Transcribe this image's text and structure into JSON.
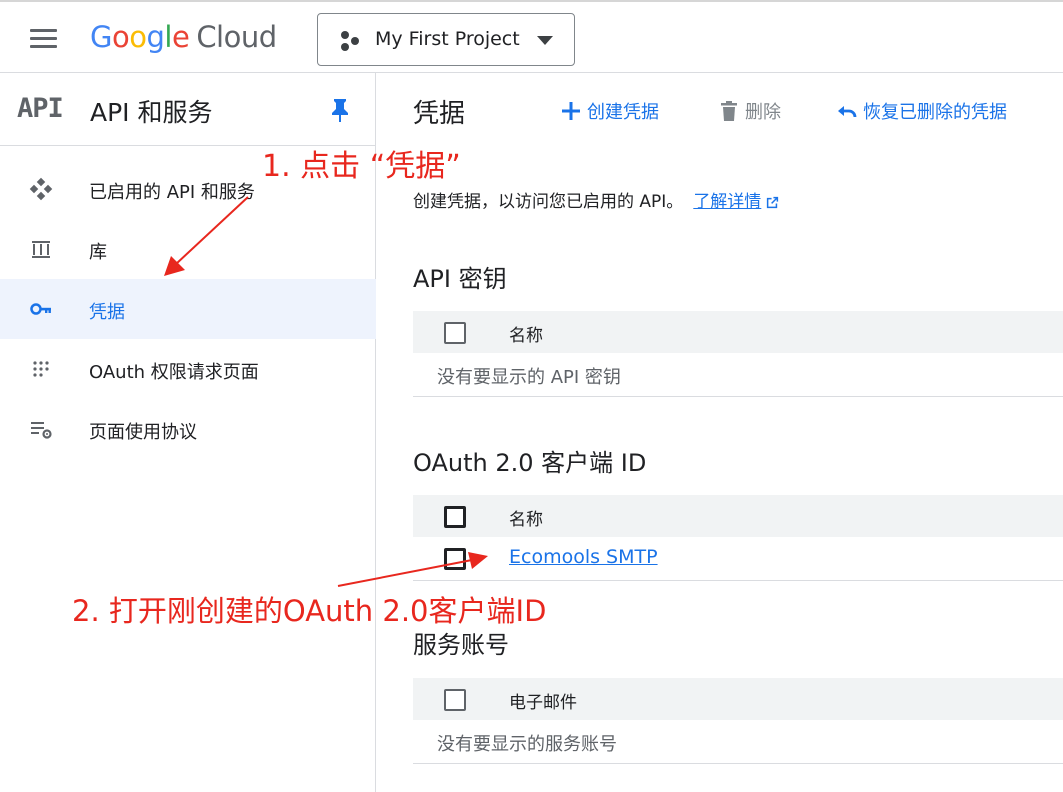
{
  "header": {
    "logo_letters": [
      "G",
      "o",
      "o",
      "g",
      "l",
      "e"
    ],
    "logo_suffix": "Cloud",
    "project": "My First Project"
  },
  "sidebar": {
    "logo_text": "API",
    "title": "API 和服务",
    "items": [
      {
        "label": "已启用的 API 和服务",
        "icon": "diamond-grid-icon",
        "active": false
      },
      {
        "label": "库",
        "icon": "library-icon",
        "active": false
      },
      {
        "label": "凭据",
        "icon": "key-icon",
        "active": true
      },
      {
        "label": "OAuth 权限请求页面",
        "icon": "dotted-grid-icon",
        "active": false
      },
      {
        "label": "页面使用协议",
        "icon": "list-settings-icon",
        "active": false
      }
    ]
  },
  "main": {
    "title": "凭据",
    "actions": {
      "create": "创建凭据",
      "delete": "删除",
      "restore": "恢复已删除的凭据"
    },
    "intro": "创建凭据，以访问您已启用的 API。",
    "learn_more": "了解详情",
    "api_keys": {
      "title": "API 密钥",
      "column": "名称",
      "empty": "没有要显示的 API 密钥"
    },
    "oauth": {
      "title": "OAuth 2.0 客户端 ID",
      "column": "名称",
      "rows": [
        "Ecomools SMTP"
      ]
    },
    "service_accounts": {
      "title": "服务账号",
      "column": "电子邮件",
      "empty": "没有要显示的服务账号"
    }
  },
  "annotations": {
    "step1": "1. 点击 “凭据”",
    "step2": "2. 打开刚创建的OAuth 2.0客户端ID"
  },
  "colors": {
    "accent": "#1a73e8",
    "annotation": "#e8271e"
  }
}
